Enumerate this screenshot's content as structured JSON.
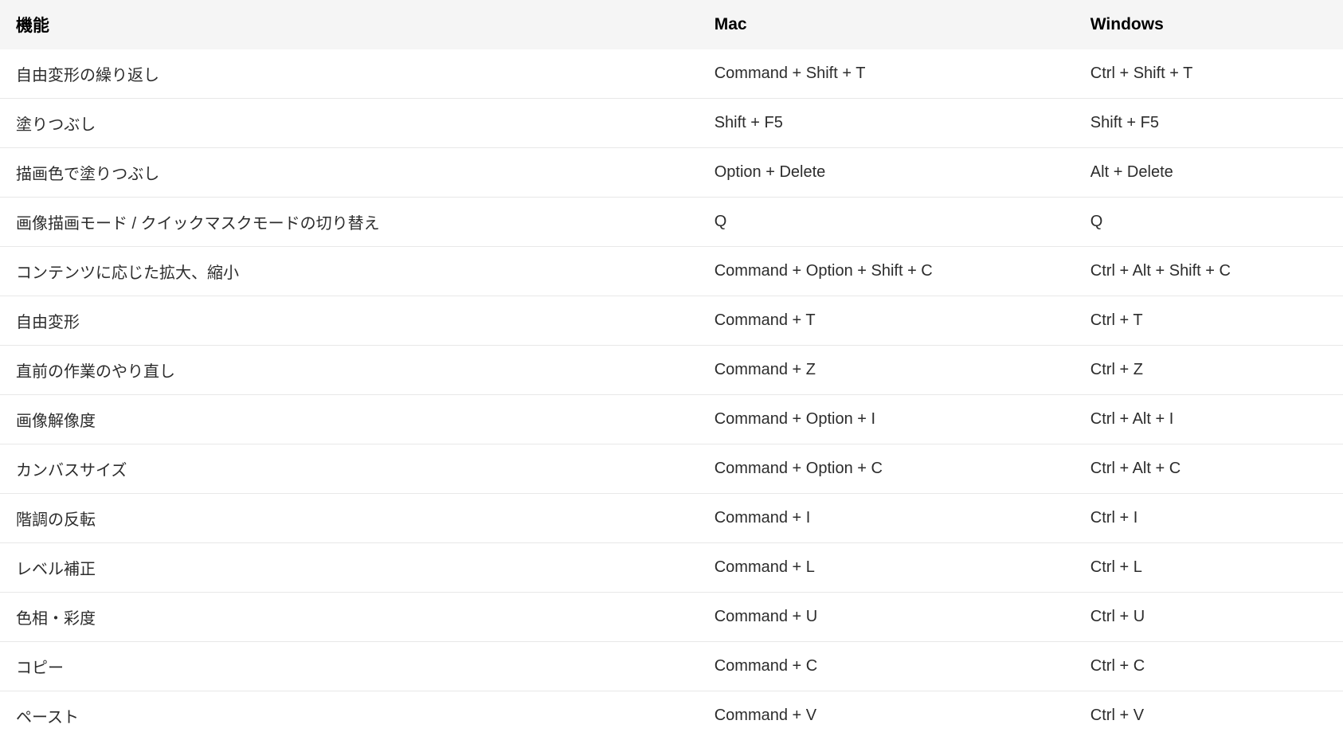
{
  "table": {
    "headers": {
      "feature": "機能",
      "mac": "Mac",
      "windows": "Windows"
    },
    "rows": [
      {
        "feature": "自由変形の繰り返し",
        "mac": "Command + Shift + T",
        "windows": "Ctrl + Shift + T"
      },
      {
        "feature": "塗りつぶし",
        "mac": "Shift + F5",
        "windows": "Shift + F5"
      },
      {
        "feature": "描画色で塗りつぶし",
        "mac": "Option + Delete",
        "windows": "Alt + Delete"
      },
      {
        "feature": "画像描画モード / クイックマスクモードの切り替え",
        "mac": "Q",
        "windows": "Q"
      },
      {
        "feature": "コンテンツに応じた拡大、縮小",
        "mac": "Command + Option + Shift + C",
        "windows": "Ctrl + Alt + Shift + C"
      },
      {
        "feature": "自由変形",
        "mac": "Command + T",
        "windows": "Ctrl + T"
      },
      {
        "feature": "直前の作業のやり直し",
        "mac": "Command + Z",
        "windows": "Ctrl + Z"
      },
      {
        "feature": "画像解像度",
        "mac": "Command + Option + I",
        "windows": "Ctrl + Alt + I"
      },
      {
        "feature": "カンバスサイズ",
        "mac": "Command + Option + C",
        "windows": "Ctrl + Alt + C"
      },
      {
        "feature": "階調の反転",
        "mac": "Command + I",
        "windows": "Ctrl + I"
      },
      {
        "feature": "レベル補正",
        "mac": "Command + L",
        "windows": "Ctrl + L"
      },
      {
        "feature": "色相・彩度",
        "mac": "Command + U",
        "windows": "Ctrl + U"
      },
      {
        "feature": "コピー",
        "mac": "Command + C",
        "windows": "Ctrl + C"
      },
      {
        "feature": "ペースト",
        "mac": "Command + V",
        "windows": "Ctrl + V"
      }
    ]
  }
}
